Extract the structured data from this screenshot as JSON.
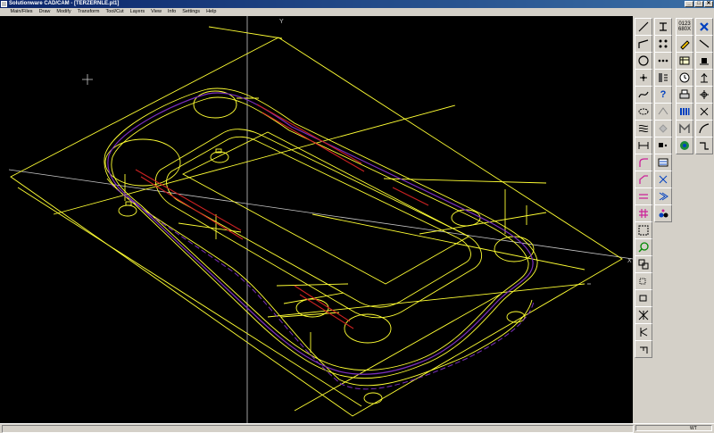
{
  "window": {
    "title": "Solutionware CAD/CAM - [TERZERNLE.pl1]",
    "buttons": [
      "_",
      "□",
      "✕"
    ]
  },
  "menu": {
    "items": [
      "Main/Files",
      "Draw",
      "Modify",
      "Transform",
      "Tool/Cut",
      "Layers",
      "View",
      "Info",
      "Settings",
      "Help"
    ]
  },
  "canvas": {
    "axis_y_label": "Y",
    "axis_x_label": "X",
    "colors": {
      "background": "#000000",
      "geometry": "#ffff33",
      "toolpath": "#7b2fbe",
      "highlight": "#cc2222",
      "axis": "#c8c8c8"
    }
  },
  "toolbar": {
    "counter_label": "0123",
    "counter_sub": "680X",
    "icons": {
      "col1": [
        "line-icon",
        "polyline-icon",
        "circle-icon",
        "point-icon",
        "spline-icon",
        "ellipse-icon",
        "hatch-icon",
        "dimension-icon",
        "fillet-icon",
        "chamfer-icon",
        "trim-icon",
        "grid-icon",
        "zoom-extents-icon",
        "zoom-icon",
        "zoom-window-icon",
        "pan-icon",
        "rotate-icon",
        "mirror-icon",
        "break-icon",
        "corner-icon"
      ],
      "col2": [
        "measure-icon",
        "array-icon",
        "dots-icon",
        "explode-icon",
        "question-icon",
        "block-icon",
        "layer-icon",
        "select-icon",
        "properties-icon",
        "nodes-icon",
        "merge-icon",
        "drop-icon"
      ],
      "col3": [
        "counter-icon",
        "edit-icon",
        "table-icon",
        "clock-icon",
        "print-icon",
        "bars-icon",
        "barcode-icon",
        "m-tool-icon",
        "globe-icon"
      ],
      "col4": [
        "close-icon",
        "diagonal-line-icon",
        "nail-icon",
        "snap-icon",
        "snap-center-icon",
        "cross-icon",
        "arc-icon",
        "step-icon"
      ]
    }
  },
  "status": {
    "left_text": "",
    "right_text": "WT"
  }
}
